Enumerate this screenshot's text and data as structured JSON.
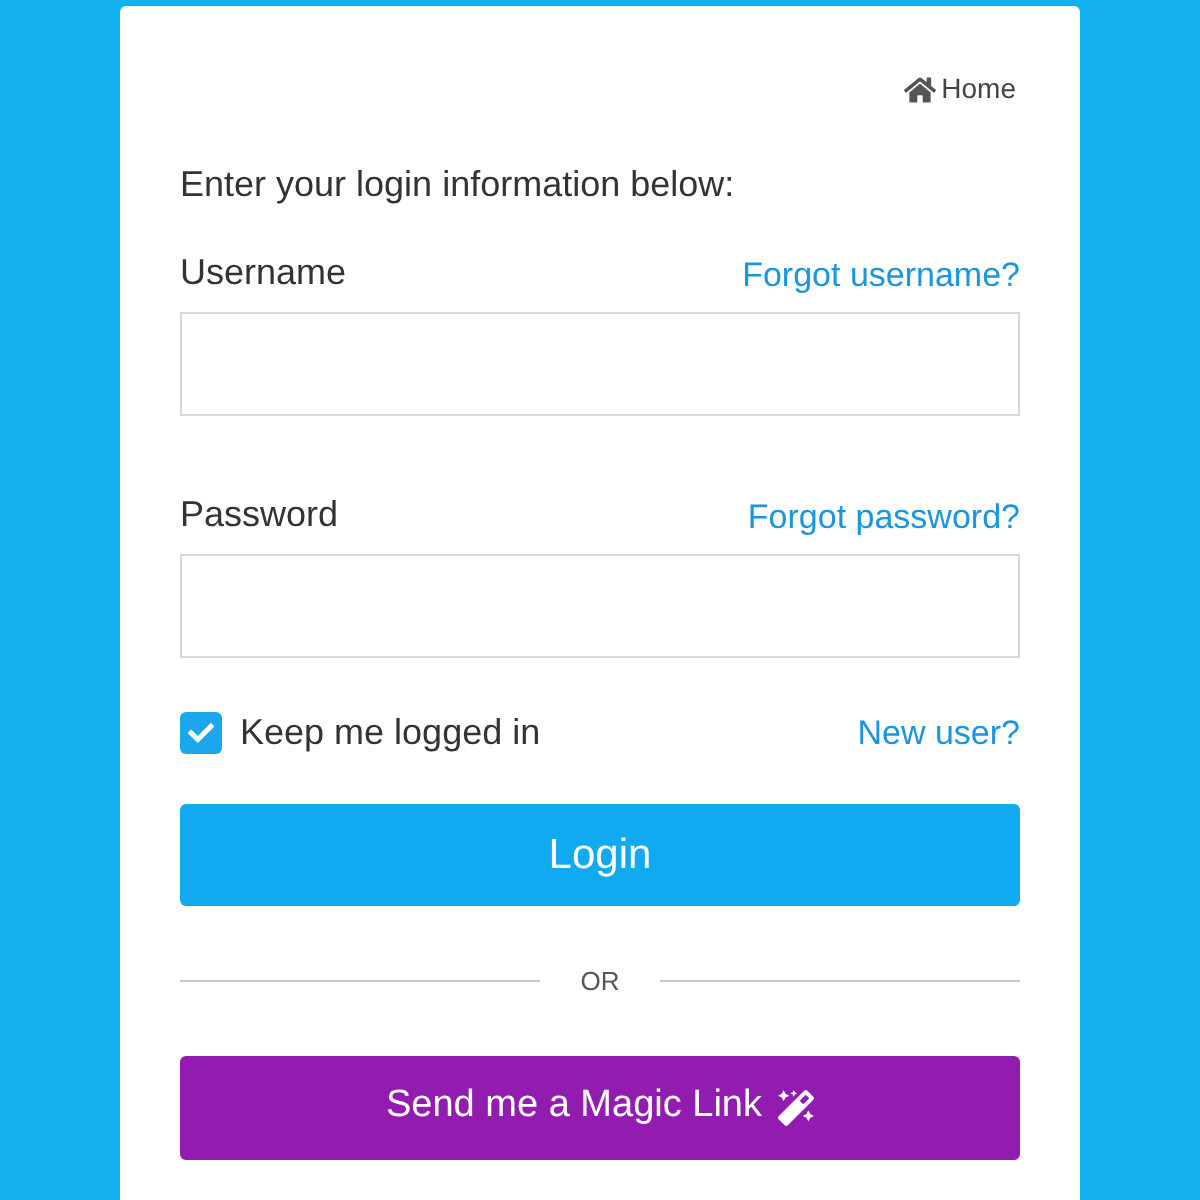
{
  "home_link": "Home",
  "intro": "Enter your login information below:",
  "fields": [
    {
      "label": "Username",
      "link": "Forgot username?"
    },
    {
      "label": "Password",
      "link": "Forgot password?"
    }
  ],
  "keep_logged_in": {
    "label": "Keep me logged in",
    "checked": true
  },
  "new_user_link": "New user?",
  "login_button": "Login",
  "divider": "OR",
  "magic_button": "Send me a Magic Link"
}
